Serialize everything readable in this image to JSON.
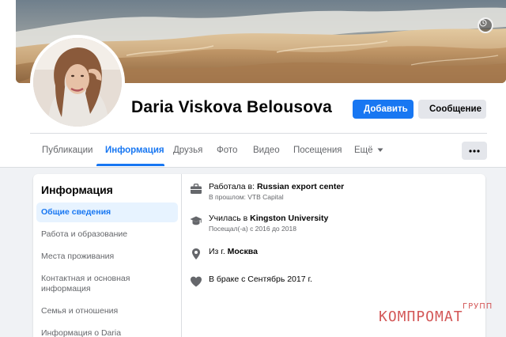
{
  "profile": {
    "name": "Daria Viskova Belousova"
  },
  "actions": {
    "add_label": "Добавить",
    "message_label": "Сообщение"
  },
  "tabs": [
    {
      "label": "Публикации",
      "active": false
    },
    {
      "label": "Информация",
      "active": true
    },
    {
      "label": "Друзья",
      "active": false
    },
    {
      "label": "Фото",
      "active": false
    },
    {
      "label": "Видео",
      "active": false
    },
    {
      "label": "Посещения",
      "active": false
    },
    {
      "label": "Ещё",
      "active": false
    }
  ],
  "about": {
    "title": "Информация",
    "nav": [
      {
        "label": "Общие сведения",
        "active": true
      },
      {
        "label": "Работа и образование",
        "active": false
      },
      {
        "label": "Места проживания",
        "active": false
      },
      {
        "label": "Контактная и основная информация",
        "active": false
      },
      {
        "label": "Семья и отношения",
        "active": false
      },
      {
        "label": "Информация о Daria",
        "active": false
      }
    ],
    "rows": [
      {
        "icon": "briefcase-icon",
        "prefix": "Работала в: ",
        "highlight": "Russian export center",
        "suffix": "",
        "sub": "В прошлом: VTB Capital"
      },
      {
        "icon": "graduation-cap-icon",
        "prefix": "Училась в ",
        "highlight": "Kingston University",
        "suffix": "",
        "sub": "Посещал(-а) с 2016 до 2018"
      },
      {
        "icon": "location-pin-icon",
        "prefix": "Из г. ",
        "highlight": "Москва",
        "suffix": "",
        "sub": ""
      },
      {
        "icon": "heart-icon",
        "prefix": "В браке с Сентябрь 2017 г.",
        "highlight": "",
        "suffix": "",
        "sub": ""
      }
    ]
  },
  "watermark": {
    "main": "КОМПРОМАТ",
    "sub": "ГРУПП"
  },
  "colors": {
    "brand_blue": "#1877f2",
    "page_bg": "#f0f2f5",
    "secondary_text": "#65676b",
    "watermark_red": "#d04a4a"
  }
}
